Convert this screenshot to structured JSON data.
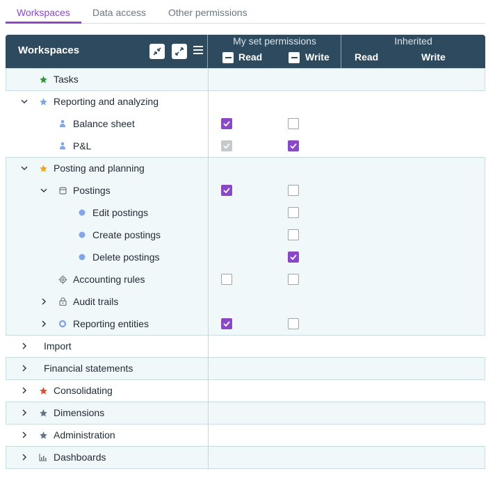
{
  "tabs": [
    {
      "label": "Workspaces",
      "active": true
    },
    {
      "label": "Data access",
      "active": false
    },
    {
      "label": "Other permissions",
      "active": false
    }
  ],
  "header": {
    "title": "Workspaces",
    "my_set_permissions": "My set permissions",
    "inherited": "Inherited",
    "read": "Read",
    "write": "Write",
    "inh_read": "Read",
    "inh_write": "Write"
  },
  "colors": {
    "accent": "#8a48c6",
    "header_bg": "#2d4a5e",
    "row_shade": "#f1f8f9"
  },
  "rows": [
    {
      "label": "Tasks",
      "icon": "star-icon-green",
      "read": null,
      "write": null
    },
    {
      "label": "Reporting and analyzing",
      "icon": "star-icon-blue",
      "expanded": true,
      "read": null,
      "write": null
    },
    {
      "label": "Balance sheet",
      "icon": "user-icon",
      "read": "checked",
      "write": "unchecked"
    },
    {
      "label": "P&L",
      "icon": "user-icon",
      "read": "disabled-checked",
      "write": "checked"
    },
    {
      "label": "Posting and planning",
      "icon": "star-icon-orange",
      "expanded": true,
      "read": null,
      "write": null
    },
    {
      "label": "Postings",
      "icon": "folder-icon",
      "expanded": true,
      "read": "checked",
      "write": "unchecked"
    },
    {
      "label": "Edit postings",
      "icon": "dot-icon",
      "read": null,
      "write": "unchecked"
    },
    {
      "label": "Create postings",
      "icon": "dot-icon",
      "read": null,
      "write": "unchecked"
    },
    {
      "label": "Delete postings",
      "icon": "dot-icon",
      "read": null,
      "write": "checked"
    },
    {
      "label": "Accounting rules",
      "icon": "gear-icon",
      "read": "unchecked",
      "write": "unchecked"
    },
    {
      "label": "Audit trails",
      "icon": "lock-icon",
      "expanded": false,
      "read": null,
      "write": null
    },
    {
      "label": "Reporting entities",
      "icon": "ring-icon",
      "expanded": false,
      "read": "checked",
      "write": "unchecked"
    },
    {
      "label": "Import",
      "expanded": false
    },
    {
      "label": "Financial statements",
      "expanded": false
    },
    {
      "label": "Consolidating",
      "icon": "star-icon-red",
      "expanded": false
    },
    {
      "label": "Dimensions",
      "icon": "star-icon-slate",
      "expanded": false
    },
    {
      "label": "Administration",
      "icon": "star-icon-slate",
      "expanded": false
    },
    {
      "label": "Dashboards",
      "icon": "chart-icon",
      "expanded": false
    }
  ]
}
